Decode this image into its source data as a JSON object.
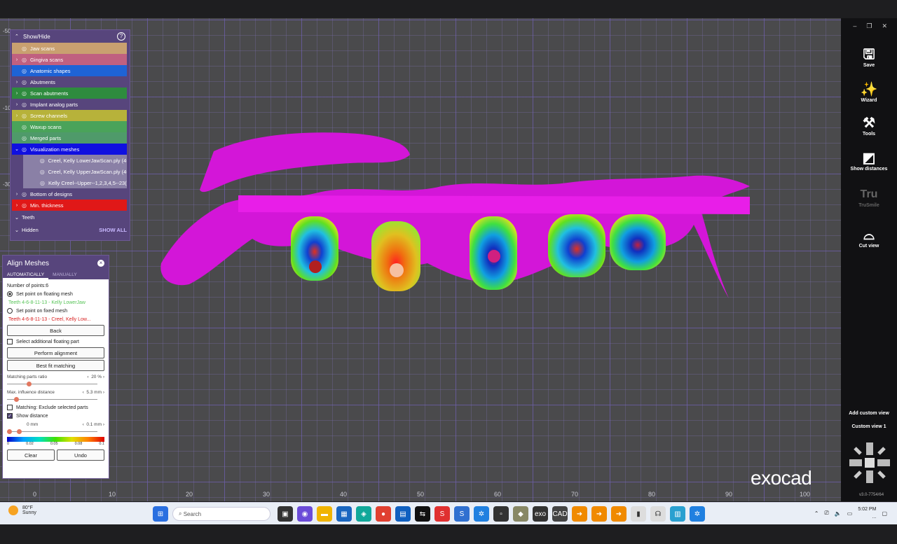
{
  "show_hide": {
    "title": "Show/Hide",
    "items": [
      {
        "label": "Jaw scans",
        "color": "#c9a070",
        "arrow": ""
      },
      {
        "label": "Gingiva scans",
        "color": "#c06080",
        "arrow": "›"
      },
      {
        "label": "Anatomic shapes",
        "color": "#1e63d6",
        "arrow": ""
      },
      {
        "label": "Abutments",
        "color": "#57457c",
        "arrow": "›"
      },
      {
        "label": "Scan abutments",
        "color": "#2e8b3e",
        "arrow": "›"
      },
      {
        "label": "Implant analog parts",
        "color": "#57457c",
        "arrow": "›"
      },
      {
        "label": "Screw channels",
        "color": "#b7b23a",
        "arrow": "›"
      },
      {
        "label": "Waxup scans",
        "color": "#4aa35a",
        "arrow": ""
      },
      {
        "label": "Merged parts",
        "color": "#4f9a6a",
        "arrow": ""
      },
      {
        "label": "Visualization meshes",
        "color": "#1010e0",
        "arrow": "⌄"
      }
    ],
    "sub_items": [
      {
        "label": "Creel, Kelly LowerJawScan.ply (4-"
      },
      {
        "label": "Creel, Kelly UpperJawScan.ply (4-"
      },
      {
        "label": "Kelly Creel--Upper--1,2,3,4,5--23("
      }
    ],
    "items2": [
      {
        "label": "Bottom of designs",
        "color": "#57457c",
        "arrow": "›"
      },
      {
        "label": "Min. thickness",
        "color": "#e01818",
        "arrow": "›"
      }
    ],
    "teeth": "Teeth",
    "hidden": "Hidden",
    "show_all": "SHOW ALL"
  },
  "align": {
    "title": "Align Meshes",
    "tab_auto": "AUTOMATICALLY",
    "tab_manual": "MANUALLY",
    "num_points": "Number of points:6",
    "floating_label": "Set point on floating mesh",
    "floating_sub": "Teeth 4-6-8-11-13 - Kelly LowerJaw",
    "fixed_label": "Set point on fixed mesh",
    "fixed_sub": "Teeth 4-6-8-11-13 - Creel, Kelly Low...",
    "back": "Back",
    "select_additional": "Select additional floating part",
    "perform": "Perform alignment",
    "best_fit": "Best fit matching",
    "ratio_label": "Matching parts ratio",
    "ratio_val": "20 %",
    "ratio_fraction": 0.22,
    "influence_label": "Max. influence distance",
    "influence_val": "5.3 mm",
    "influence_fraction": 0.08,
    "exclude_label": "Matching: Exclude selected parts",
    "show_distance": "Show distance",
    "dist_min": "0 mm",
    "dist_max": "0.1 mm",
    "grad_labels": [
      "0",
      "0.02",
      "0.05",
      "0.08",
      "0.1"
    ],
    "clear": "Clear",
    "undo": "Undo"
  },
  "viewport": {
    "x_ticks": [
      "0",
      "10",
      "20",
      "30",
      "40",
      "50",
      "60",
      "70",
      "80",
      "90",
      "100"
    ],
    "y_ticks": [
      "-50",
      "-10",
      "-30"
    ],
    "brand": "exocad",
    "version": "v3.0-7754/64"
  },
  "toolbar": {
    "save": "Save",
    "wizard": "Wizard",
    "tools": "Tools",
    "show_distances": "Show distances",
    "trusmile": "TruSmile",
    "tru": "Tru",
    "cut_view": "Cut view",
    "add_custom_view": "Add custom view",
    "custom_view_1": "Custom view 1"
  },
  "taskbar": {
    "temp": "80°F",
    "weather": "Sunny",
    "search": "Search",
    "time": "5:02 PM",
    "date": "..."
  }
}
